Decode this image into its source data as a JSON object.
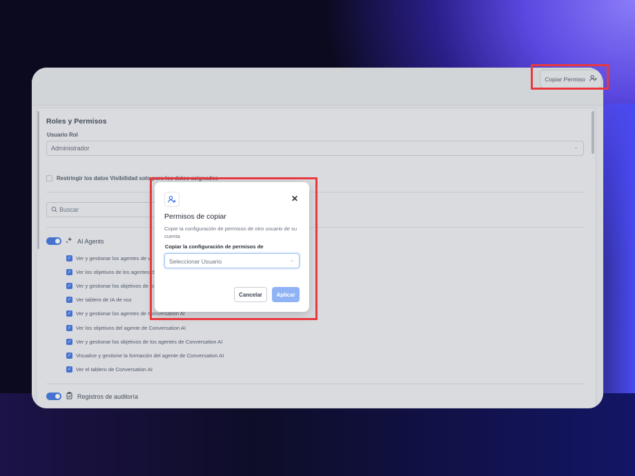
{
  "header": {
    "copy_permission_label": "Copiar Permiso",
    "copy_permission_icon": "user-plus-icon"
  },
  "roles": {
    "title": "Roles y Permisos",
    "user_role_label": "Usuario Rol",
    "user_role_value": "Administrador",
    "restrict_label": "Restringir los datos Visibilidad solo pa",
    "restrict_hidden_tail": "ra los datos asignados",
    "search_placeholder": "Buscar"
  },
  "groups": [
    {
      "name": "AI Agents",
      "icon": "sparkles-icon",
      "enabled": true,
      "permissions": [
        "Ver y gestionar los agentes de v",
        "Ver los objetivos de los agentes d",
        "Ver y gestionar los objetivos de lo",
        "Ver tablero de IA de voz",
        "Ver y gestionar los agentes de Conversation AI",
        "Ver los objetivos del agente de Conversation AI",
        "Ver y gestionar los objetivos de los agentes de Conversation AI",
        "Visualice y gestione la formación del agente de Conversation AI",
        "Ver el tablero de Conversation AI"
      ]
    },
    {
      "name": "Registros de auditoría",
      "icon": "clipboard-check-icon",
      "enabled": true
    }
  ],
  "modal": {
    "icon": "user-plus-icon",
    "title": "Permisos de copiar",
    "description": "Copie la configuración de permisos de otro usuario de su cuenta",
    "field_label": "Copiar la configuración de permisos de",
    "select_placeholder": "Seleccionar Usuario",
    "cancel_label": "Cancelar",
    "apply_label": "Aplicar"
  },
  "colors": {
    "accent": "#3b6fe0",
    "highlight": "#e8383d",
    "apply_disabled": "#8fb3f5"
  }
}
